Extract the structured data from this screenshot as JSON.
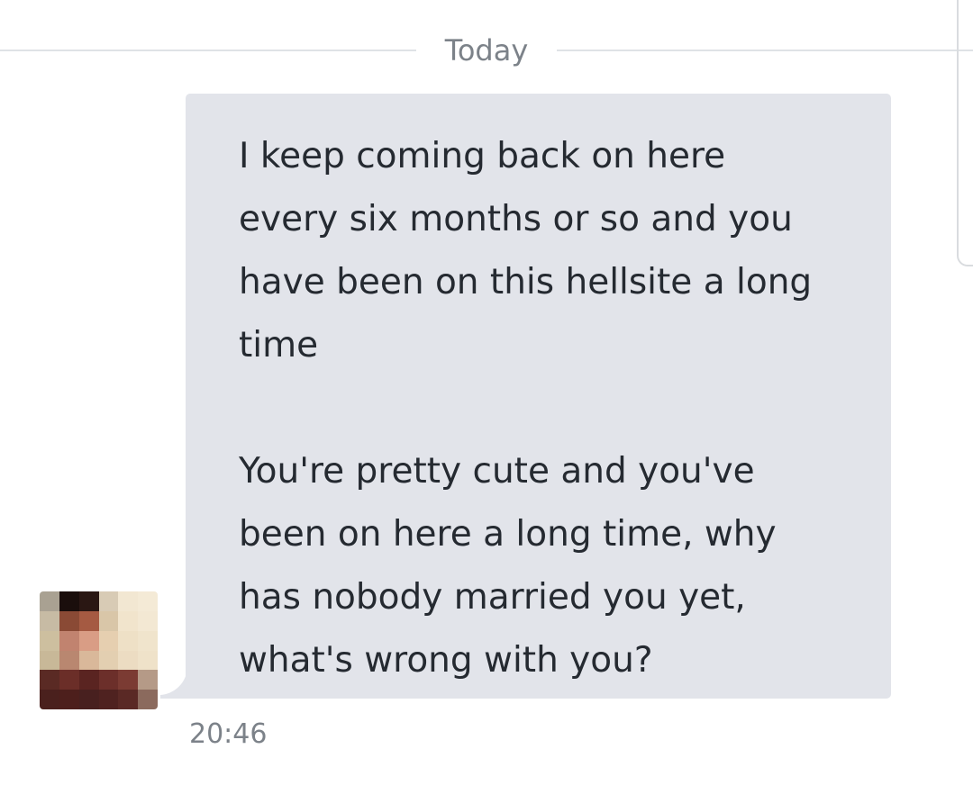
{
  "divider": {
    "label": "Today"
  },
  "message": {
    "paragraphs": [
      "I keep coming back on here\nevery six months or so and you\nhave been on this hellsite a long\ntime",
      "You're pretty cute and you've\nbeen on here a  long time, why\nhas nobody married you yet,\nwhat's wrong with you?"
    ],
    "timestamp": "20:46"
  },
  "colors": {
    "bubble": "#e2e4ea",
    "text": "#252a31",
    "muted": "#7c8289",
    "divider_line": "#dfe2e6"
  },
  "avatar": {
    "icon": "pixelated-profile-photo",
    "pixels": [
      [
        "#a9a192",
        "#1a0e0c",
        "#2a1713",
        "#d8cbb5",
        "#f2e7d2",
        "#f4ead6"
      ],
      [
        "#c7bba4",
        "#8a4a35",
        "#a55a42",
        "#d9c6a8",
        "#f1e4cc",
        "#f3e8d3"
      ],
      [
        "#cdbf9f",
        "#c1836f",
        "#d99d85",
        "#e6cfb0",
        "#eee0c6",
        "#f0e4cc"
      ],
      [
        "#c8b898",
        "#b98770",
        "#d9b89a",
        "#e3cfb1",
        "#ecdcc2",
        "#efe2c9"
      ],
      [
        "#5a2a24",
        "#6b2e28",
        "#5a2421",
        "#6c2f2a",
        "#7b3b33",
        "#b59a87"
      ],
      [
        "#4a201d",
        "#4d1f1c",
        "#48201f",
        "#4f2220",
        "#5a2925",
        "#8b6a5d"
      ]
    ]
  }
}
